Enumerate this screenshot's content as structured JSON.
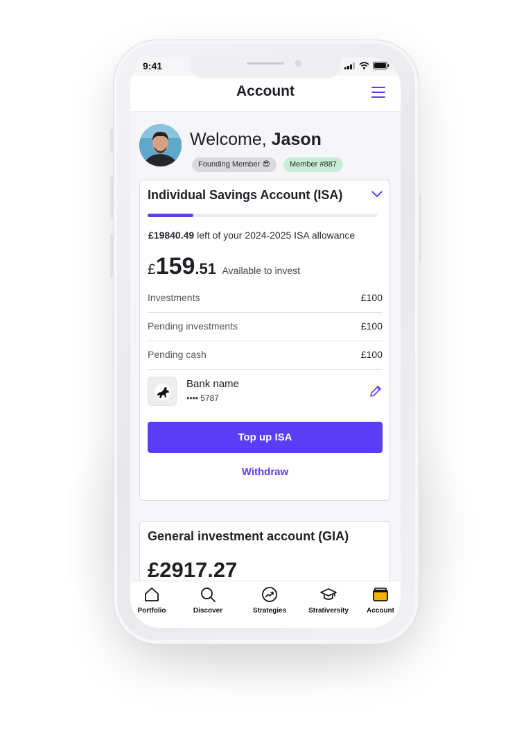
{
  "status_bar": {
    "time": "9:41"
  },
  "app_bar": {
    "title": "Account",
    "menu_icon": "hamburger-menu-icon"
  },
  "welcome": {
    "greeting": "Welcome, ",
    "name": "Jason",
    "badges": [
      "Founding Member 😎",
      "Member #887"
    ]
  },
  "isa": {
    "title": "Individual Savings Account (ISA)",
    "allowance_progress": 0.2,
    "allowance_amount": "£19840.49",
    "allowance_text": " left of your 2024-2025 ISA allowance",
    "available_currency": "£",
    "available_whole": "159",
    "available_decimal": ".51",
    "available_label": "Available to invest",
    "rows": [
      {
        "label": "Investments",
        "value": "£100"
      },
      {
        "label": "Pending investments",
        "value": "£100"
      },
      {
        "label": "Pending cash",
        "value": "£100"
      }
    ],
    "bank": {
      "name": "Bank name",
      "account": "•••• 5787"
    },
    "top_up_label": "Top up ISA",
    "withdraw_label": "Withdraw"
  },
  "gia": {
    "title": "General investment account (GIA)",
    "value": "£2917.27"
  },
  "tabs": [
    {
      "label": "Portfolio",
      "icon": "home-icon"
    },
    {
      "label": "Discover",
      "icon": "search-icon"
    },
    {
      "label": "Strategies",
      "icon": "trending-up-icon"
    },
    {
      "label": "Strativersity",
      "icon": "graduation-cap-icon"
    },
    {
      "label": "Account",
      "icon": "wallet-icon"
    }
  ],
  "colors": {
    "accent": "#5b3df5",
    "wallet": "#f5b400",
    "badge_green": "#c7ecd7"
  }
}
